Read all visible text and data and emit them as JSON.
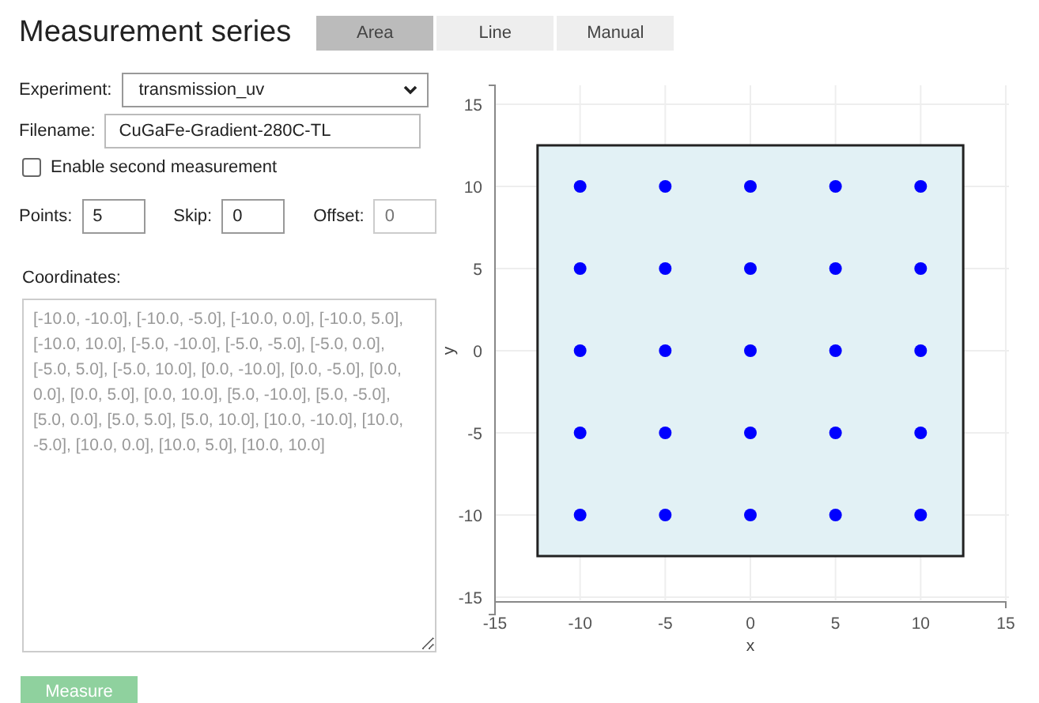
{
  "header": {
    "title": "Measurement series"
  },
  "tabs": [
    {
      "label": "Area",
      "selected": true
    },
    {
      "label": "Line",
      "selected": false
    },
    {
      "label": "Manual",
      "selected": false
    }
  ],
  "form": {
    "experiment": {
      "label": "Experiment:",
      "value": "transmission_uv"
    },
    "filename": {
      "label": "Filename:",
      "value": "CuGaFe-Gradient-280C-TL"
    },
    "second_measurement": {
      "label": "Enable second measurement",
      "checked": false
    },
    "points": {
      "label": "Points:",
      "value": "5",
      "disabled": false
    },
    "skip": {
      "label": "Skip:",
      "value": "0",
      "disabled": false
    },
    "offset": {
      "label": "Offset:",
      "placeholder": "0",
      "disabled": true
    },
    "coordinates": {
      "label": "Coordinates:",
      "placeholder": "[-10.0, -10.0], [-10.0, -5.0], [-10.0, 0.0], [-10.0, 5.0], [-10.0, 10.0], [-5.0, -10.0], [-5.0, -5.0], [-5.0, 0.0], [-5.0, 5.0], [-5.0, 10.0], [0.0, -10.0], [0.0, -5.0], [0.0, 0.0], [0.0, 5.0], [0.0, 10.0], [5.0, -10.0], [5.0, -5.0], [5.0, 0.0], [5.0, 5.0], [5.0, 10.0], [10.0, -10.0], [10.0, -5.0], [10.0, 0.0], [10.0, 5.0], [10.0, 10.0]"
    },
    "measure_button": {
      "label": "Measure",
      "disabled": true
    }
  },
  "plot": {
    "chart_data": {
      "type": "scatter",
      "xlabel": "x",
      "ylabel": "y",
      "x": [
        -10,
        -10,
        -10,
        -10,
        -10,
        -5,
        -5,
        -5,
        -5,
        -5,
        0,
        0,
        0,
        0,
        0,
        5,
        5,
        5,
        5,
        5,
        10,
        10,
        10,
        10,
        10
      ],
      "series": [
        {
          "color": "#0000ff",
          "values": [
            -10,
            -5,
            0,
            5,
            10,
            -10,
            -5,
            0,
            5,
            10,
            -10,
            -5,
            0,
            5,
            10,
            -10,
            -5,
            0,
            5,
            10,
            -10,
            -5,
            0,
            5,
            10
          ]
        }
      ],
      "xlim": [
        -15,
        15
      ],
      "ylim": [
        -15,
        15
      ],
      "xticks": [
        -15,
        -10,
        -5,
        0,
        5,
        10,
        15
      ],
      "yticks": [
        -15,
        -10,
        -5,
        0,
        5,
        10,
        15
      ],
      "grid": true,
      "bands": [
        {
          "axis": "x",
          "from": -12.5,
          "to": 12.5,
          "color": "#e2f1f5"
        }
      ]
    }
  }
}
